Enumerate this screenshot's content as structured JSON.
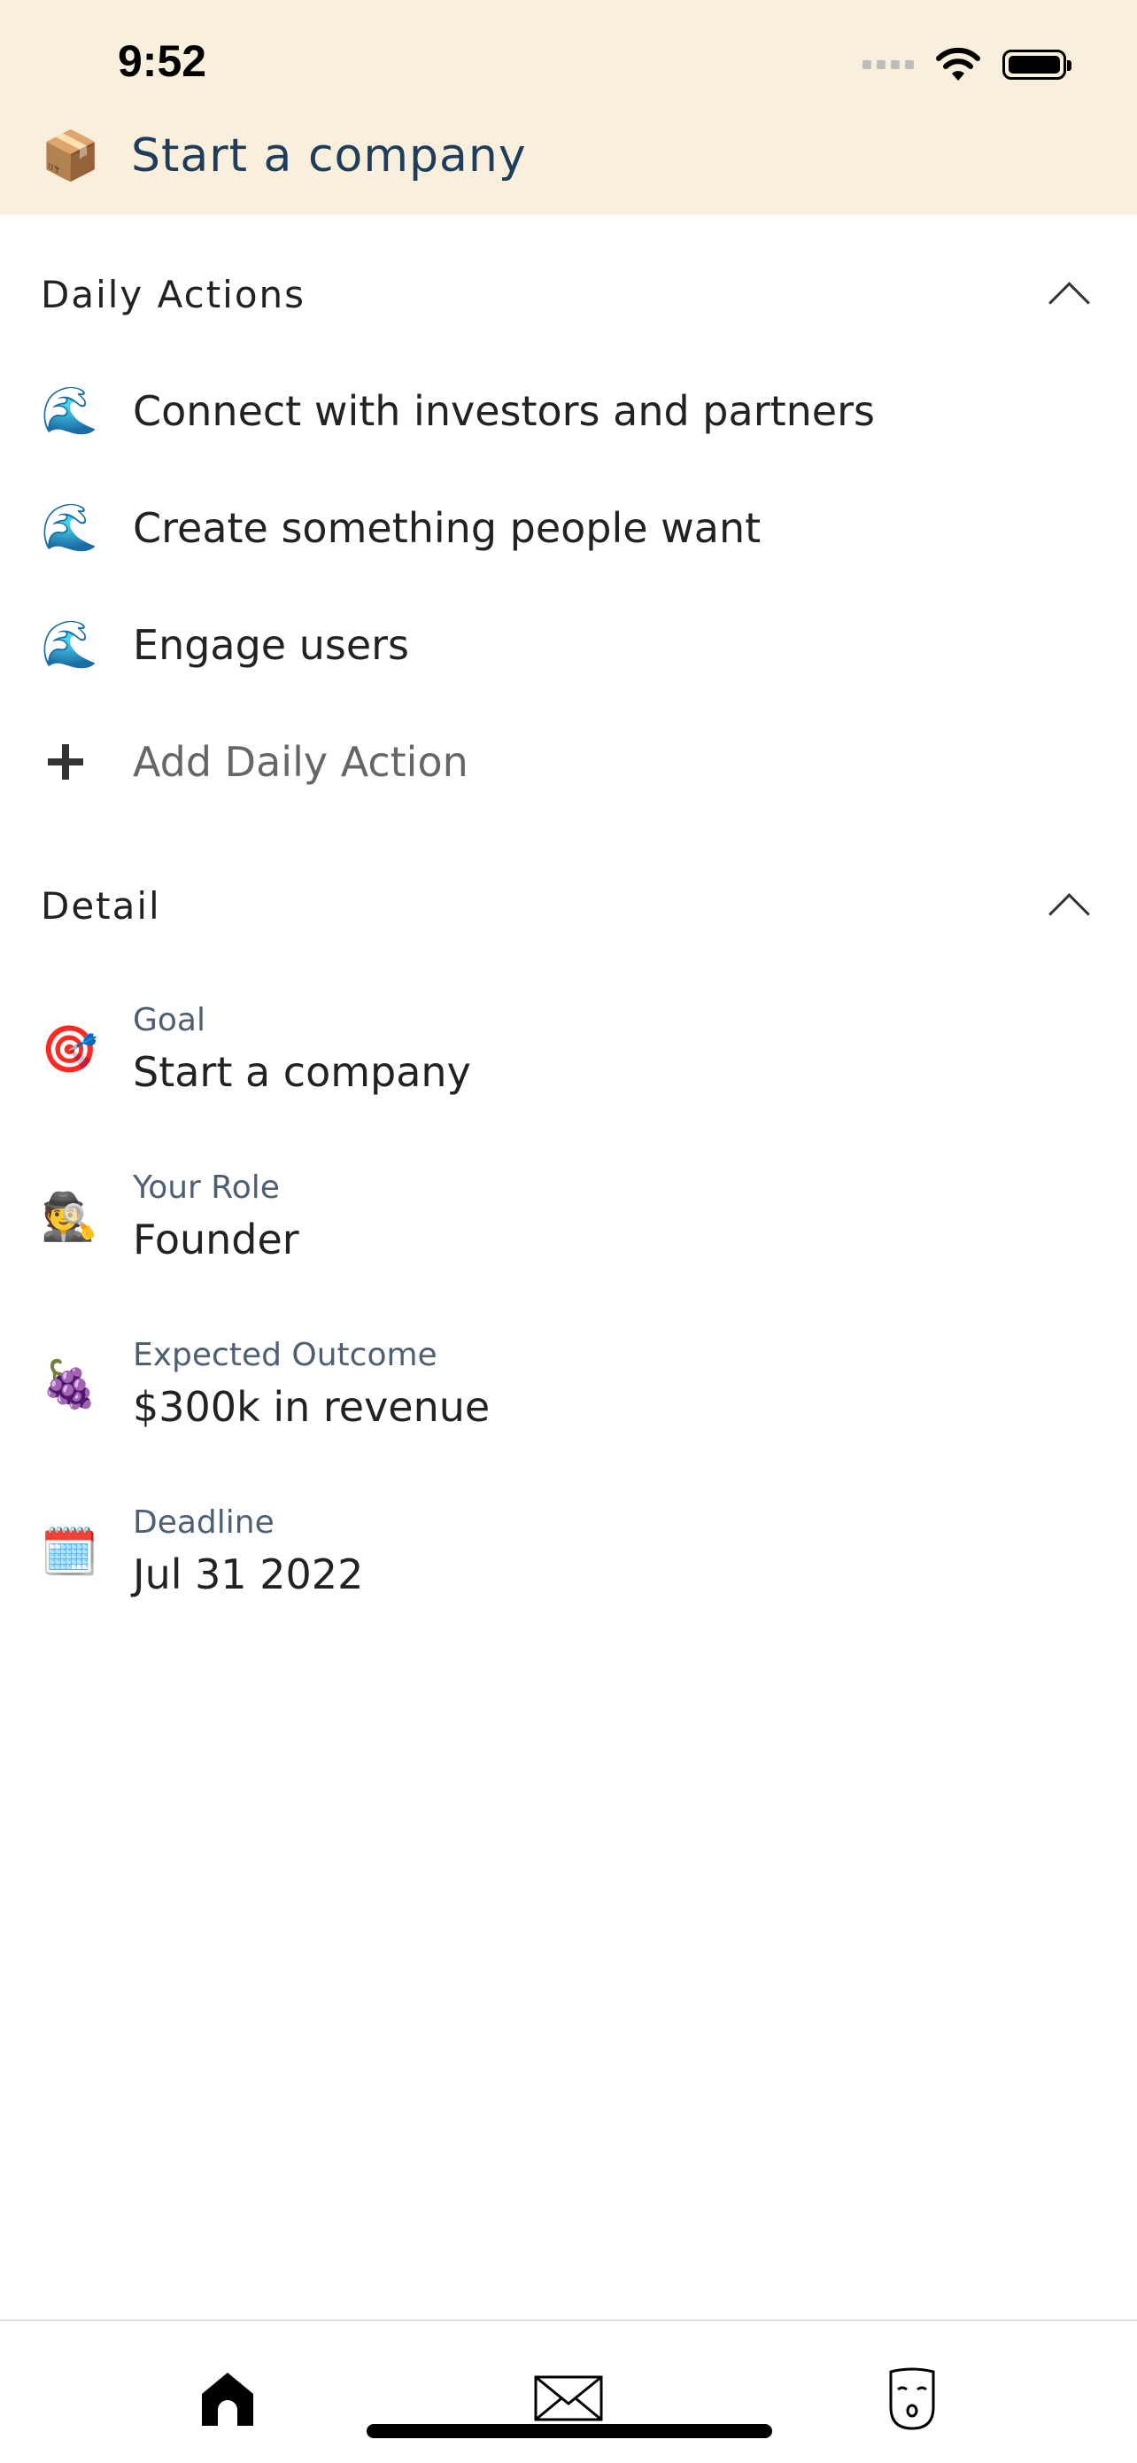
{
  "status_bar": {
    "time": "9:52"
  },
  "header": {
    "title": "Start a company",
    "icon": "📦"
  },
  "daily_actions": {
    "title": "Daily Actions",
    "items": [
      {
        "icon": "🌊",
        "label": "Connect with investors and partners"
      },
      {
        "icon": "🌊",
        "label": "Create something people want"
      },
      {
        "icon": "🌊",
        "label": "Engage users"
      }
    ],
    "add_label": "Add Daily Action"
  },
  "detail": {
    "title": "Detail",
    "fields": [
      {
        "icon": "🎯",
        "label": "Goal",
        "value": "Start a company"
      },
      {
        "icon": "🕵️",
        "label": "Your Role",
        "value": "Founder"
      },
      {
        "icon": "🍇",
        "label": "Expected Outcome",
        "value": "$300k in revenue"
      },
      {
        "icon": "🗓️",
        "label": "Deadline",
        "value": "Jul 31 2022"
      }
    ]
  },
  "tabbar": {
    "tabs": [
      {
        "icon": "home-icon"
      },
      {
        "icon": "mail-icon"
      },
      {
        "icon": "face-icon"
      }
    ]
  }
}
